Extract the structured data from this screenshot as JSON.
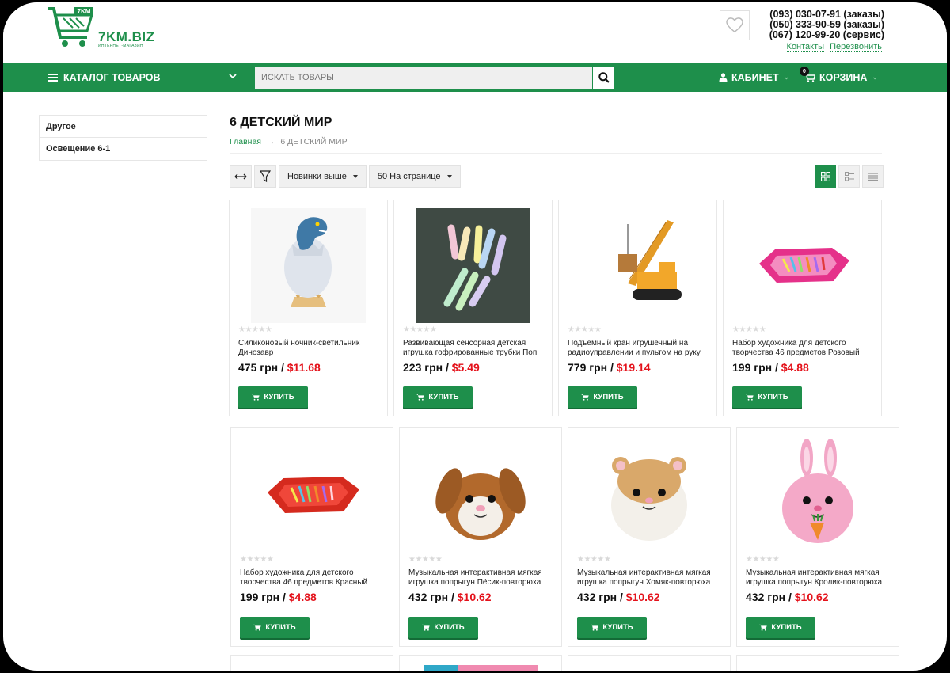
{
  "brand": {
    "name": "7KM.BIZ",
    "tagline": "ИНТЕРНЕТ-МАГАЗИН",
    "badge": "7KM",
    "color": "#1e8f4b"
  },
  "contacts": {
    "phones": [
      "(093) 030-07-91 (заказы)",
      "(050) 333-90-59 (заказы)",
      "(067) 120-99-20 (сервис)"
    ],
    "links": [
      "Контакты",
      "Перезвонить"
    ]
  },
  "nav": {
    "catalog_label": "КАТАЛОГ ТОВАРОВ",
    "search_placeholder": "ИСКАТЬ ТОВАРЫ",
    "cabinet_label": "КАБИНЕТ",
    "cart_label": "КОРЗИНА",
    "cart_count": "0"
  },
  "sidebar": {
    "items": [
      {
        "label": "Другое"
      },
      {
        "label": "Освещение 6-1"
      }
    ]
  },
  "main": {
    "title": "6 ДЕТСКИЙ МИР",
    "breadcrumb": {
      "home": "Главная",
      "sep": "→",
      "current": "6 ДЕТСКИЙ МИР"
    },
    "toolbar": {
      "sort": "Новинки выше",
      "per_page": "50 На странице"
    }
  },
  "buy_label": "КУПИТЬ",
  "rating_stars": "★★★★★",
  "products": [
    {
      "name": "Силиконовый ночник-светильник Динозавр",
      "uah": "475 грн",
      "usd": "$11.68",
      "image": "dinosaur-egg-lamp"
    },
    {
      "name": "Развивающая сенсорная детская игрушка гофрированные трубки Поп",
      "uah": "223 грн",
      "usd": "$5.49",
      "image": "pop-tubes"
    },
    {
      "name": "Подъемный кран игрушечный на радиоуправлении и пультом на руку",
      "uah": "779 грн",
      "usd": "$19.14",
      "image": "toy-crane"
    },
    {
      "name": "Набор художника для детского творчества 46 предметов Розовый",
      "uah": "199 грн",
      "usd": "$4.88",
      "image": "art-set-pink"
    },
    {
      "name": "Набор художника для детского творчества 46 предметов Красный",
      "uah": "199 грн",
      "usd": "$4.88",
      "image": "art-set-red"
    },
    {
      "name": "Музыкальная интерактивная мягкая игрушка попрыгун Пёсик-повторюха",
      "uah": "432 грн",
      "usd": "$10.62",
      "image": "plush-puppy"
    },
    {
      "name": "Музыкальная интерактивная мягкая игрушка попрыгун Хомяк-повторюха",
      "uah": "432 грн",
      "usd": "$10.62",
      "image": "plush-hamster"
    },
    {
      "name": "Музыкальная интерактивная мягкая игрушка попрыгун Кролик-повторюха",
      "uah": "432 грн",
      "usd": "$10.62",
      "image": "plush-bunny"
    }
  ]
}
